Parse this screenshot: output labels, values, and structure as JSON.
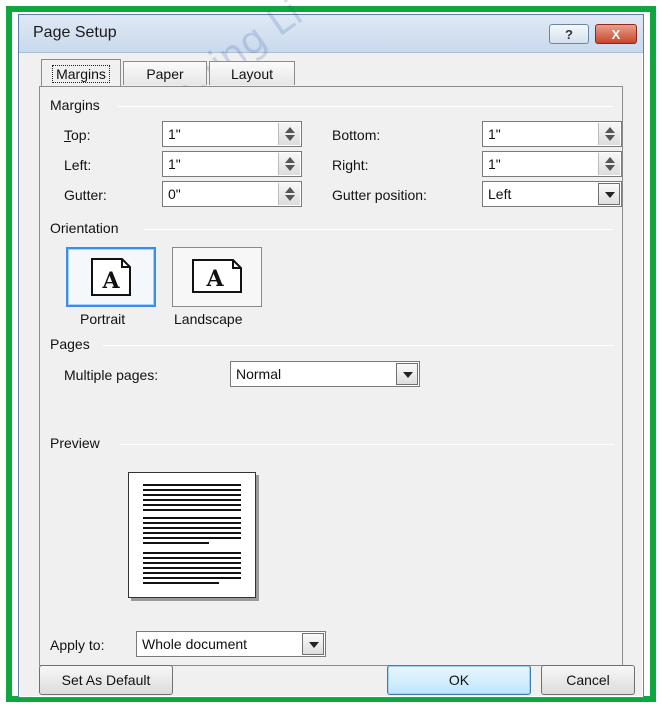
{
  "window": {
    "title": "Page Setup",
    "help_glyph": "?",
    "close_glyph": "X"
  },
  "tabs": [
    {
      "label": "Margins"
    },
    {
      "label": "Paper"
    },
    {
      "label": "Layout"
    }
  ],
  "margins": {
    "group_label": "Margins",
    "top_label": "Top:",
    "top_value": "1\"",
    "bottom_label": "Bottom:",
    "bottom_value": "1\"",
    "left_label": "Left:",
    "left_value": "1\"",
    "right_label": "Right:",
    "right_value": "1\"",
    "gutter_label": "Gutter:",
    "gutter_value": "0\"",
    "gutter_position_label": "Gutter position:",
    "gutter_position_value": "Left"
  },
  "orientation": {
    "group_label": "Orientation",
    "portrait_label": "Portrait",
    "landscape_label": "Landscape",
    "glyph": "A",
    "selected": "Portrait"
  },
  "pages": {
    "group_label": "Pages",
    "multiple_pages_label": "Multiple pages:",
    "multiple_pages_value": "Normal"
  },
  "preview": {
    "group_label": "Preview"
  },
  "apply_to": {
    "label": "Apply to:",
    "value": "Whole document"
  },
  "buttons": {
    "set_default": "Set As Default",
    "ok": "OK",
    "cancel": "Cancel"
  },
  "watermark": "Learning Li",
  "colors": {
    "frame": "#0fa640",
    "selection": "#3a8ee6",
    "close": "#c7452a"
  }
}
